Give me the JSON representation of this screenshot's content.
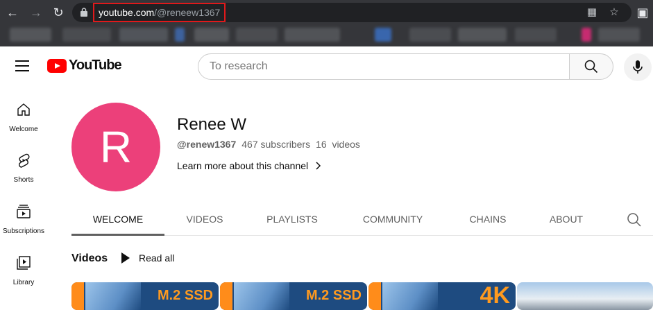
{
  "browser": {
    "url_domain": "youtube.com",
    "url_path": "/@reneew1367"
  },
  "masthead": {
    "logo_text": "YouTube",
    "search_placeholder": "To research"
  },
  "guide": [
    {
      "label": "Welcome",
      "icon": "home-icon"
    },
    {
      "label": "Shorts",
      "icon": "shorts-icon"
    },
    {
      "label": "Subscriptions",
      "icon": "subscriptions-icon"
    },
    {
      "label": "Library",
      "icon": "library-icon"
    }
  ],
  "channel": {
    "avatar_letter": "R",
    "avatar_color": "#ec407a",
    "name": "Renee W",
    "handle": "@renew1367",
    "subscribers": "467 subscribers",
    "videos_count": "16  videos",
    "learn_more": "Learn more about this channel"
  },
  "tabs": [
    "WELCOME",
    "VIDEOS",
    "PLAYLISTS",
    "COMMUNITY",
    "CHAINS",
    "ABOUT"
  ],
  "videos_section": {
    "title": "Videos",
    "play_all": "Read all",
    "thumbnails": [
      {
        "caption": "M.2 SSD"
      },
      {
        "caption": "M.2 SSD"
      },
      {
        "caption": "4K"
      },
      {
        "caption": ""
      }
    ]
  }
}
